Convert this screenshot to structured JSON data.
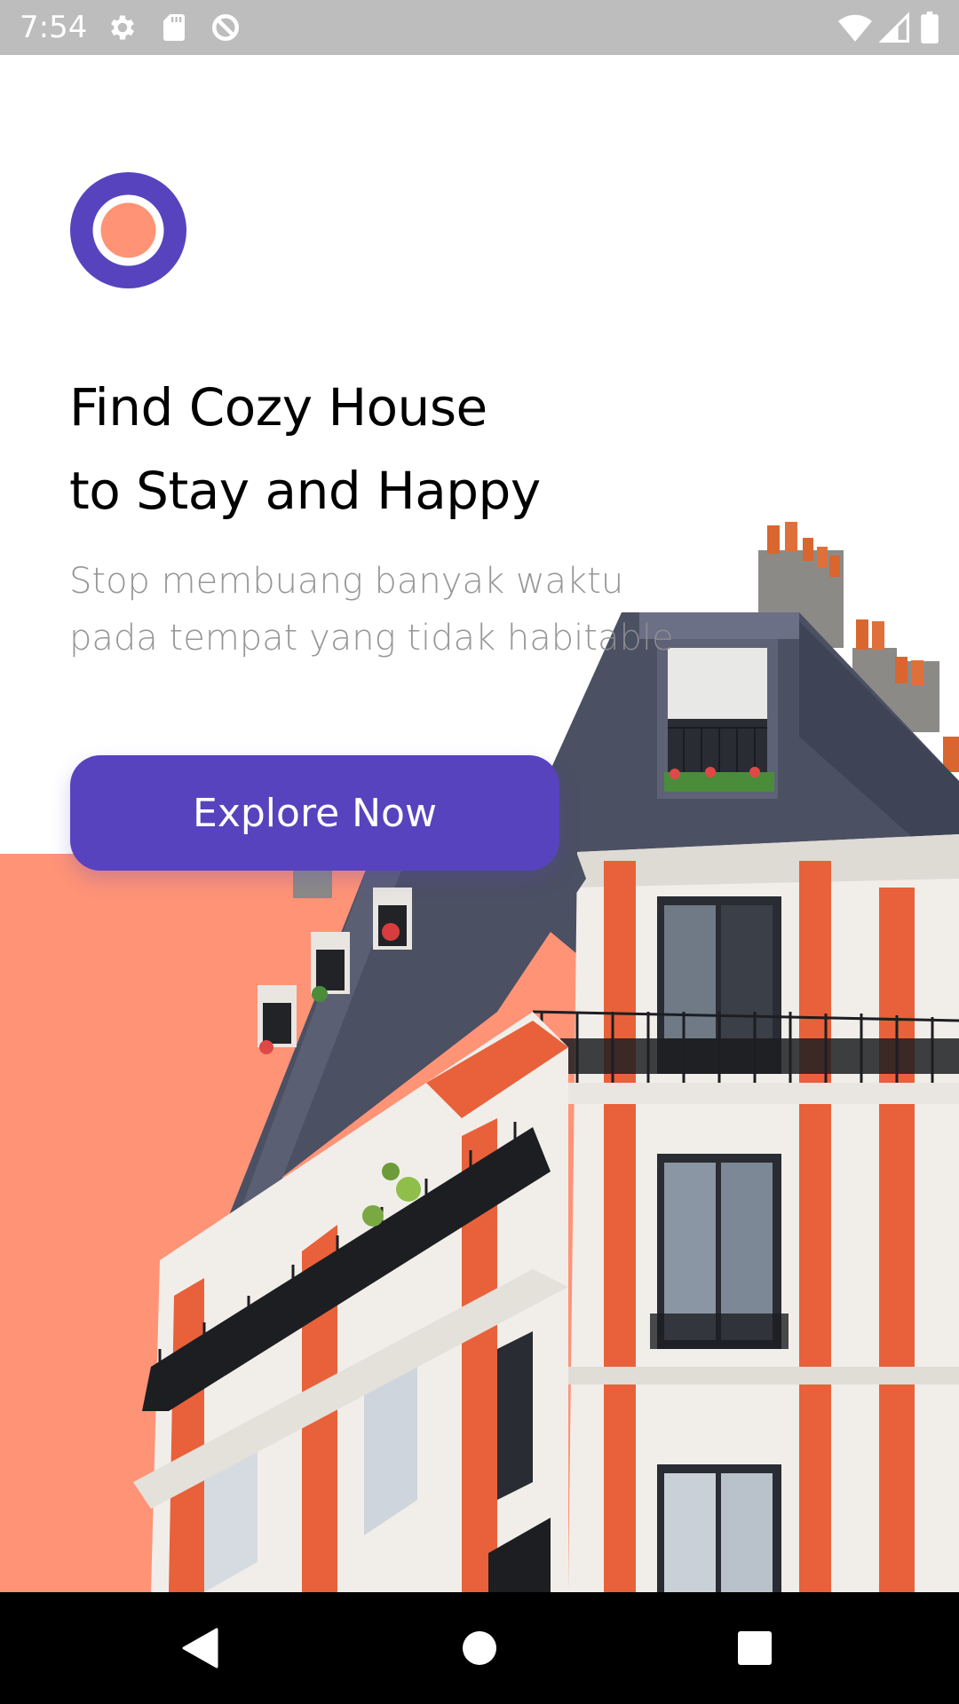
{
  "status_bar": {
    "time": "7:54",
    "icons": [
      "settings-icon",
      "sd-card-icon",
      "data-saver-icon",
      "wifi-icon",
      "cellular-signal-icon",
      "battery-icon"
    ]
  },
  "logo": {
    "icon": "ring-logo-icon",
    "outer_color": "#5843be",
    "inner_color": "#ff9376"
  },
  "hero": {
    "title_line1": "Find Cozy House",
    "title_line2": "to Stay and Happy",
    "subtitle_line1": "Stop membuang banyak waktu",
    "subtitle_line2": "pada tempat yang tidak habitable"
  },
  "cta": {
    "label": "Explore Now",
    "color": "#5843be"
  },
  "illustration": {
    "icon": "apartment-building-image",
    "backdrop_color": "#ff9376"
  },
  "nav_bar": {
    "back_icon": "back-triangle-icon",
    "home_icon": "home-circle-icon",
    "recents_icon": "recents-square-icon"
  }
}
